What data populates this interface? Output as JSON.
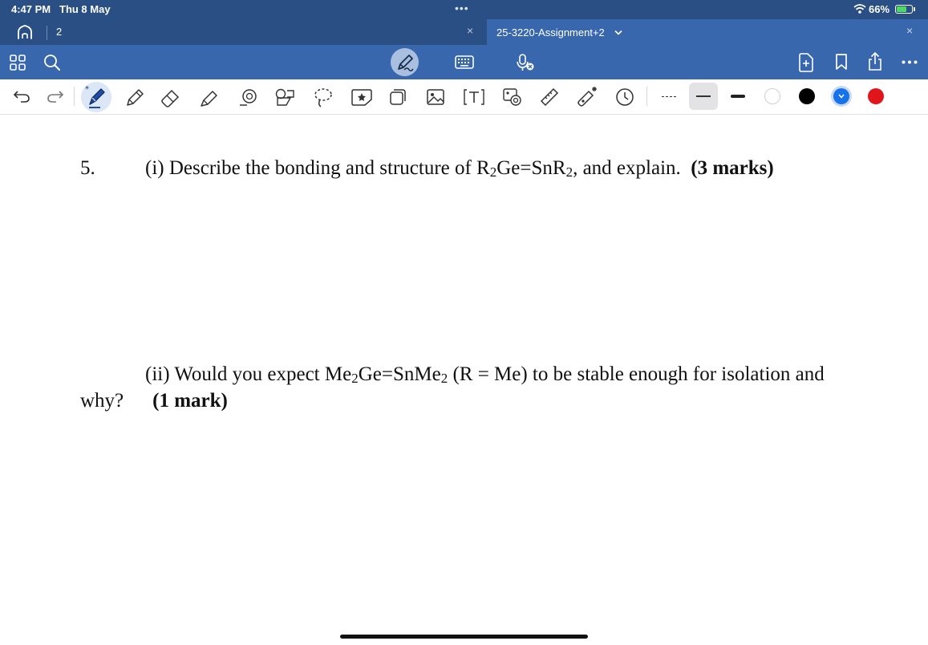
{
  "status_bar": {
    "time": "4:47 PM",
    "date": "Thu 8 May",
    "battery_percent": "66%",
    "battery_level": 0.66,
    "charging": true
  },
  "tab_bar": {
    "open_tabs_count": "2",
    "active_tab_title": "25-3220-Assignment+2",
    "close_symbol": "×"
  },
  "main_toolbar": {
    "left_icons": [
      "grid-icon",
      "search-icon"
    ],
    "center_icons": [
      "pen-mode-icon",
      "keyboard-icon",
      "dictation-icon"
    ],
    "right_icons": [
      "add-page-icon",
      "bookmark-icon",
      "share-icon",
      "more-icon"
    ]
  },
  "drawing_toolbar": {
    "tools": [
      "undo-icon",
      "redo-icon",
      "fountain-pen-icon",
      "pencil-icon",
      "eraser-icon",
      "highlighter-icon",
      "shape-icon",
      "element-icon",
      "lasso-icon",
      "sticker-icon",
      "sticky-note-icon",
      "image-icon",
      "text-box-icon",
      "scan-icon",
      "ruler-icon",
      "laser-pointer-icon",
      "clock-icon"
    ],
    "selected_tool": "fountain-pen-icon",
    "stroke_styles": [
      "dashed",
      "thin",
      "thick"
    ],
    "selected_stroke": "thin",
    "colors": [
      "#ffffff",
      "#000000",
      "#1673ea",
      "#e0161b"
    ],
    "selected_color": "#1673ea"
  },
  "document": {
    "question_number": "5.",
    "part1": {
      "prefix": "(i) Describe the bonding and structure of R",
      "sub1": "2",
      "mid": "Ge=SnR",
      "sub2": "2",
      "suffix": ", and explain.  ",
      "marks": "(3 marks)"
    },
    "part2": {
      "prefix": "(ii) Would you expect Me",
      "sub1": "2",
      "mid": "Ge=SnMe",
      "sub2": "2",
      "suffix": " (R = Me) to be stable enough for isolation and",
      "line2": "why?",
      "marks": "(1 mark)"
    }
  }
}
